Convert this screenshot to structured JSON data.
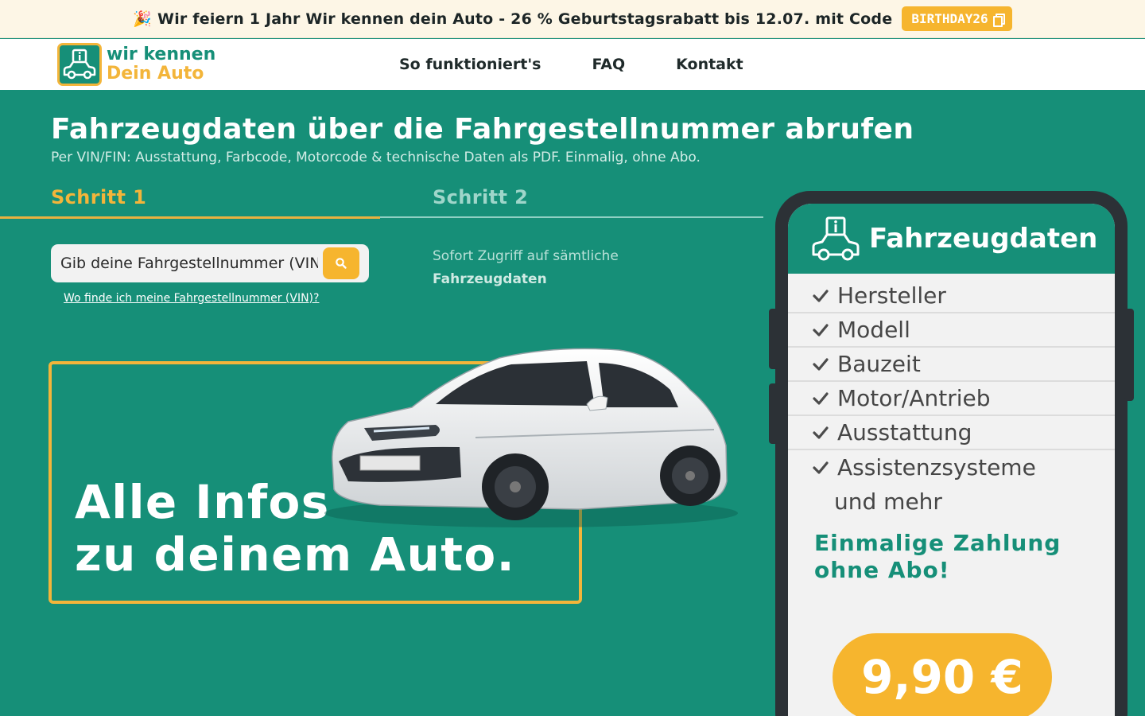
{
  "promo": {
    "glyph": "🎉",
    "text": "Wir feiern 1 Jahr Wir kennen dein Auto - 26 % Geburtstagsrabatt bis 12.07. mit Code",
    "code": "BIRTHDAY26"
  },
  "header": {
    "logo_top": "wir kennen",
    "logo_bottom": "Dein Auto",
    "nav": [
      "So funktioniert's",
      "FAQ",
      "Kontakt"
    ]
  },
  "hero": {
    "title": "Fahrzeugdaten über die Fahrgestellnummer abrufen",
    "subtitle": "Per VIN/FIN: Ausstattung, Farbcode, Motorcode & technische Daten als PDF. Einmalig, ohne Abo."
  },
  "steps": {
    "step1": "Schritt 1",
    "step2": "Schritt 2",
    "search_placeholder": "Gib deine Fahrgestellnummer (VIN) ein",
    "help_link": "Wo finde ich meine Fahrgestellnummer (VIN)?",
    "step2_text": "Sofort Zugriff auf sämtliche",
    "step2_strong": "Fahrzeugdaten"
  },
  "banner": {
    "line1": "Alle Infos",
    "line2": "zu deinem Auto."
  },
  "phone": {
    "title": "Fahrzeugdaten",
    "features": [
      "Hersteller",
      "Modell",
      "Bauzeit",
      "Motor/Antrieb",
      "Ausstattung",
      "Assistenzsysteme"
    ],
    "more": "und mehr",
    "payment_line1": "Einmalige Zahlung",
    "payment_line2": "ohne Abo!",
    "price": "9,90 €"
  },
  "colors": {
    "brand_green": "#168f78",
    "accent_yellow": "#f6b52e",
    "promo_background": "#fdf6e6"
  },
  "icons": [
    "party-icon",
    "copy-icon",
    "logo-car-info-icon",
    "search-icon",
    "car-image",
    "car-info-icon",
    "check-icon"
  ]
}
